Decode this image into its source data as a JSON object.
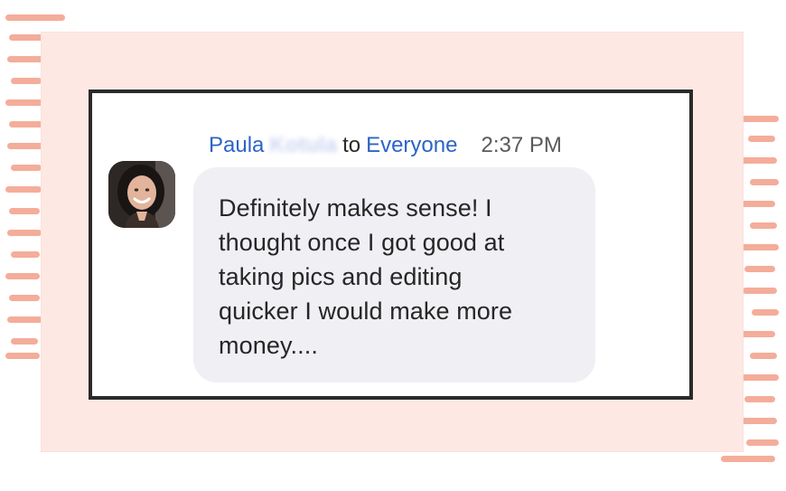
{
  "chat_message": {
    "sender_first_name": "Paula",
    "sender_last_name_blurred": "Kotula",
    "to_word": "to",
    "recipient": "Everyone",
    "time": "2:37 PM",
    "message": "Definitely makes sense! I\nthought once I got good at\ntaking pics and editing\nquicker I would make more\nmoney...."
  },
  "colors": {
    "frame_pink": "#fde8e3",
    "stroke_coral": "#f3a691",
    "name_blue": "#2d64c7",
    "bubble_bg": "#efeff4",
    "panel_border": "#2a2a2a"
  },
  "icons": {
    "avatar": "user-avatar-photo"
  }
}
